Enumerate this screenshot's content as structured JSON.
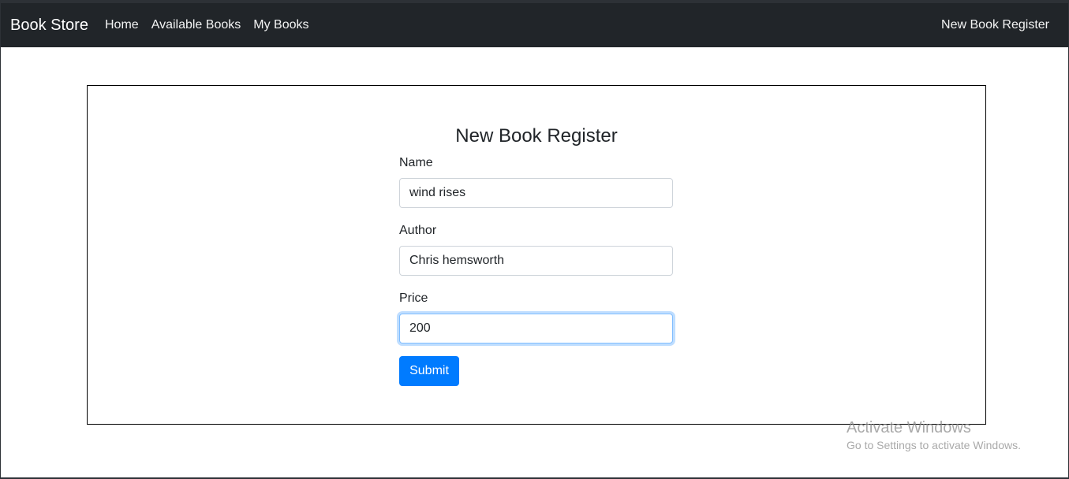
{
  "navbar": {
    "brand": "Book Store",
    "links": [
      "Home",
      "Available Books",
      "My Books"
    ],
    "right_link": "New Book Register",
    "bg_color": "#212529"
  },
  "form": {
    "title": "New Book Register",
    "fields": [
      {
        "label": "Name",
        "value": "wind rises"
      },
      {
        "label": "Author",
        "value": "Chris hemsworth"
      },
      {
        "label": "Price",
        "value": "200"
      }
    ],
    "submit_label": "Submit",
    "accent_color": "#007bff"
  },
  "watermark": {
    "title": "Activate Windows",
    "subtitle": "Go to Settings to activate Windows."
  }
}
